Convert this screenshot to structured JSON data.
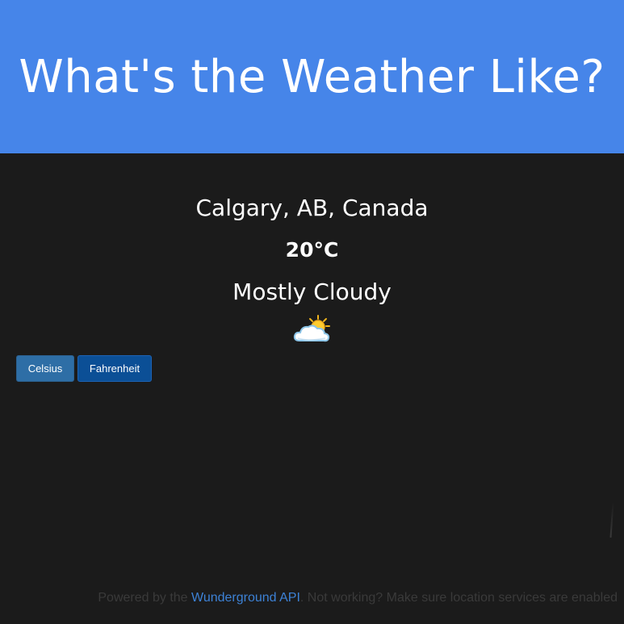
{
  "header": {
    "title": "What's the Weather Like?"
  },
  "weather": {
    "location": "Calgary, AB, Canada",
    "temperature": "20°C",
    "condition": "Mostly Cloudy",
    "icon": "partly-cloudy-icon"
  },
  "units": {
    "celsius_label": "Celsius",
    "fahrenheit_label": "Fahrenheit"
  },
  "footer": {
    "prefix": "Powered by the ",
    "link_text": "Wunderground API",
    "suffix": ". Not working? Make sure location services are enabled"
  },
  "colors": {
    "header_bg": "#4685e9",
    "page_bg": "#1b1b1b",
    "link": "#3d82d6"
  }
}
